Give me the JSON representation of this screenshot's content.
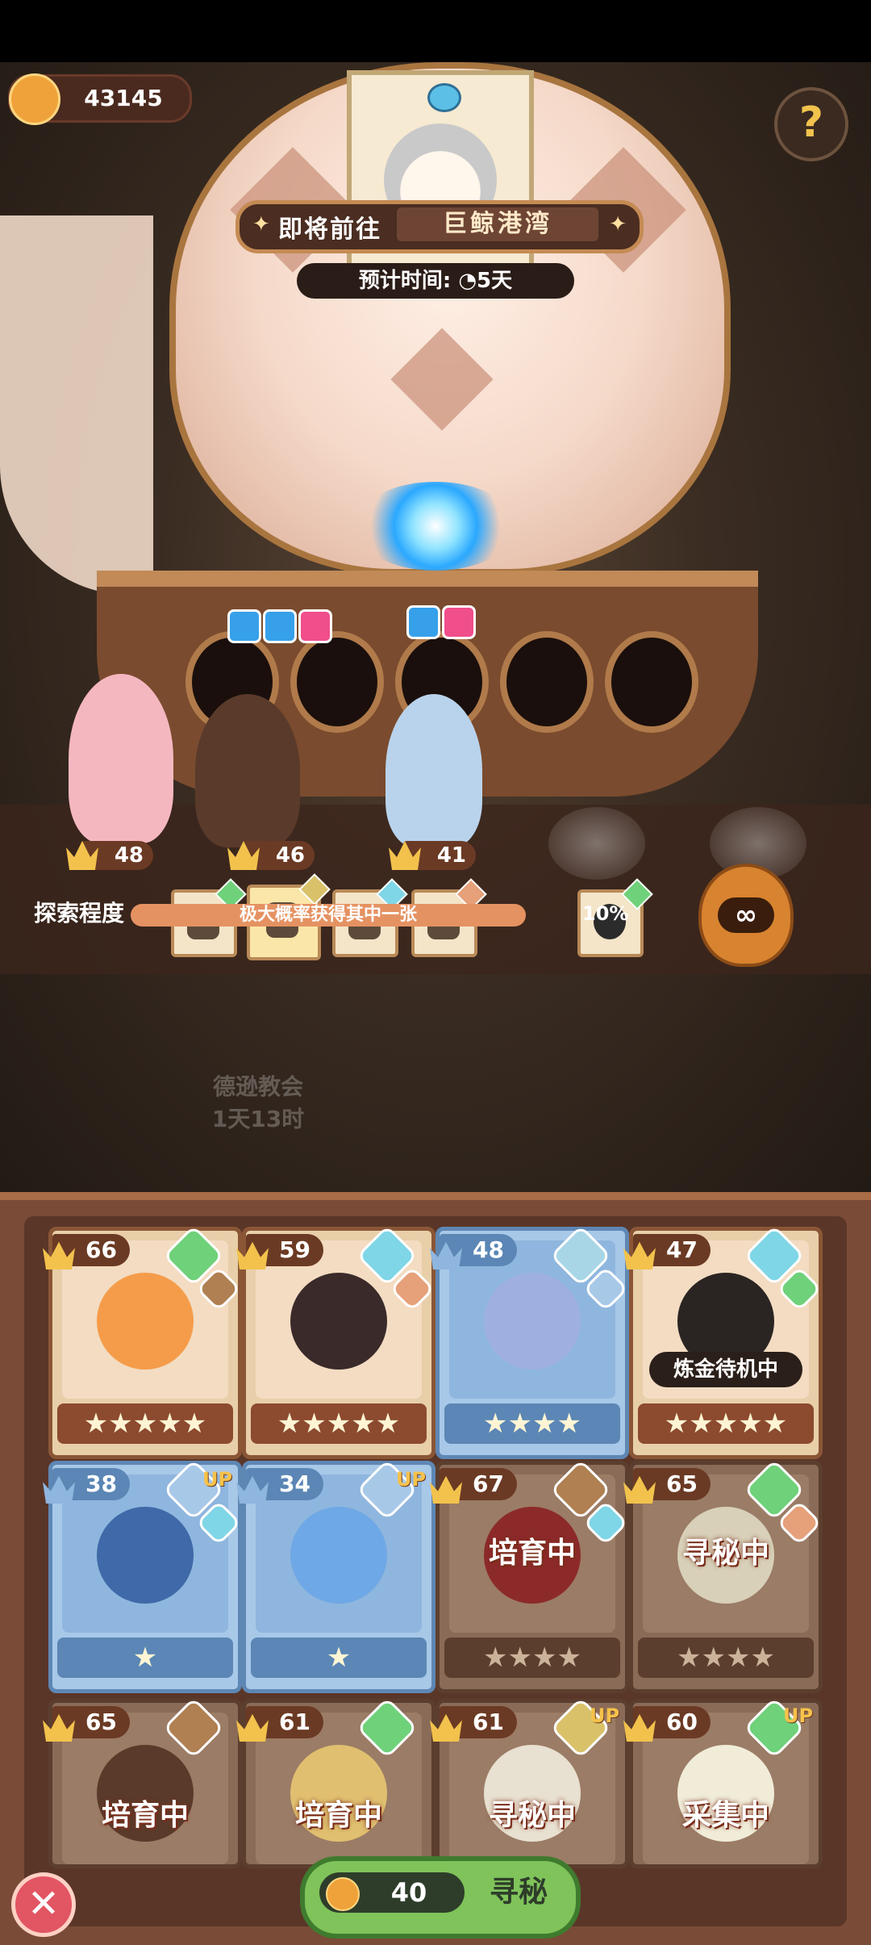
{
  "currency": {
    "amount": "43145"
  },
  "destination": {
    "label": "即将前往",
    "name": "巨鲸港湾"
  },
  "trip": {
    "time_label": "预计时间:",
    "time_value": "5天"
  },
  "ship_heroes": [
    {
      "level": "48"
    },
    {
      "level": "46"
    },
    {
      "level": "41"
    }
  ],
  "explore": {
    "label": "探索程度",
    "bar_text": "极大概率获得其中一张",
    "percent": "10%",
    "bag_symbol": "∞"
  },
  "background_place": {
    "line1": "德逊教会",
    "line2": "1天13时"
  },
  "roster": [
    {
      "level": "66",
      "stars": "★★★★★",
      "status": ""
    },
    {
      "level": "59",
      "stars": "★★★★★",
      "status": ""
    },
    {
      "level": "48",
      "stars": "★★★★",
      "status": ""
    },
    {
      "level": "47",
      "stars": "★★★★★",
      "status": "炼金待机中"
    },
    {
      "level": "38",
      "stars": "★",
      "status": "",
      "up": "UP"
    },
    {
      "level": "34",
      "stars": "★",
      "status": "",
      "up": "UP"
    },
    {
      "level": "67",
      "stars": "★★★★",
      "status": "培育中"
    },
    {
      "level": "65",
      "stars": "★★★★",
      "status": "寻秘中"
    },
    {
      "level": "65",
      "stars": "",
      "status": "培育中"
    },
    {
      "level": "61",
      "stars": "",
      "status": "培育中"
    },
    {
      "level": "61",
      "stars": "",
      "status": "寻秘中",
      "up": "UP"
    },
    {
      "level": "60",
      "stars": "",
      "status": "采集中",
      "up": "UP"
    }
  ],
  "footer": {
    "close_symbol": "✕",
    "cost": "40",
    "action_label": "寻秘"
  }
}
